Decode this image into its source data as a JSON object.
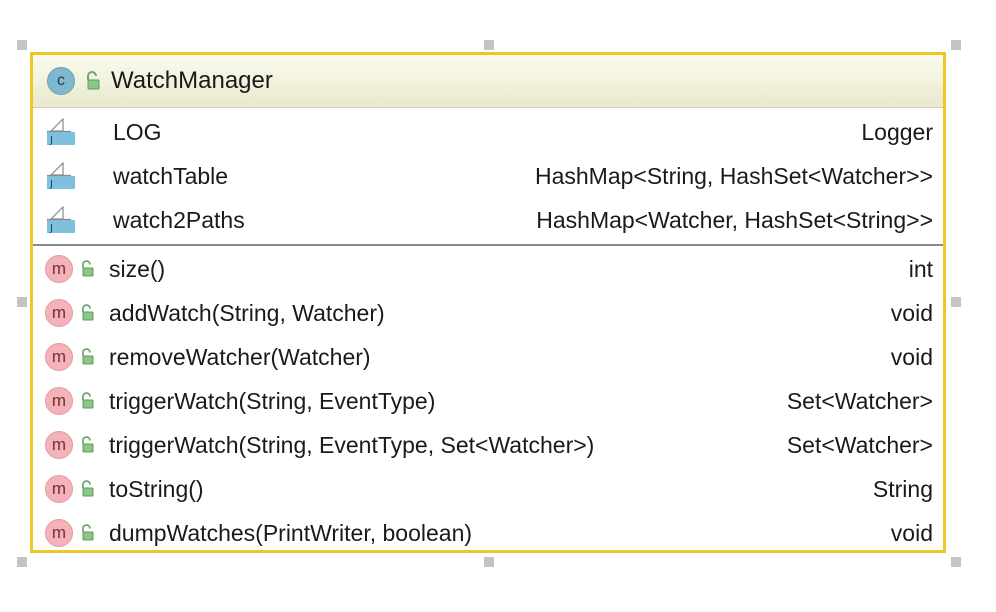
{
  "class": {
    "kind_icon": "c-icon",
    "kind_letter": "c",
    "name": "WatchManager",
    "accent_border": "#f0c526",
    "header_bg": "#efefd6"
  },
  "fields": [
    {
      "icon": "field-icon",
      "name": "LOG",
      "type": "Logger"
    },
    {
      "icon": "field-icon",
      "name": "watchTable",
      "type": "HashMap<String, HashSet<Watcher>>"
    },
    {
      "icon": "field-icon",
      "name": "watch2Paths",
      "type": "HashMap<Watcher, HashSet<String>>"
    }
  ],
  "methods": [
    {
      "icon": "m-icon",
      "letter": "m",
      "name": "size()",
      "type": "int"
    },
    {
      "icon": "m-icon",
      "letter": "m",
      "name": "addWatch(String, Watcher)",
      "type": "void"
    },
    {
      "icon": "m-icon",
      "letter": "m",
      "name": "removeWatcher(Watcher)",
      "type": "void"
    },
    {
      "icon": "m-icon",
      "letter": "m",
      "name": "triggerWatch(String, EventType)",
      "type": "Set<Watcher>"
    },
    {
      "icon": "m-icon",
      "letter": "m",
      "name": "triggerWatch(String, EventType, Set<Watcher>)",
      "type": "Set<Watcher>"
    },
    {
      "icon": "m-icon",
      "letter": "m",
      "name": "toString()",
      "type": "String"
    },
    {
      "icon": "m-icon",
      "letter": "m",
      "name": "dumpWatches(PrintWriter, boolean)",
      "type": "void"
    }
  ]
}
